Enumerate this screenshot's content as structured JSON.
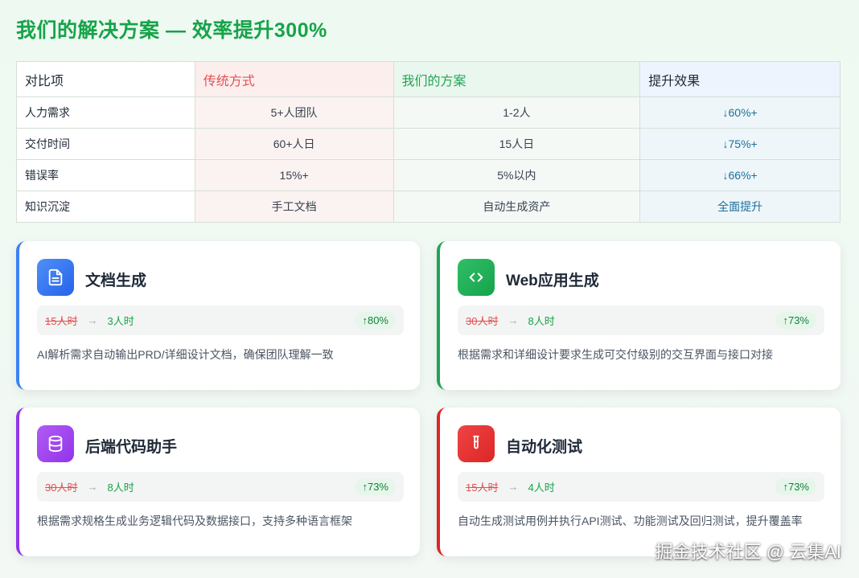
{
  "title": "我们的解决方案 — 效率提升300%",
  "table": {
    "headers": [
      "对比项",
      "传统方式",
      "我们的方案",
      "提升效果"
    ],
    "rows": [
      [
        "人力需求",
        "5+人团队",
        "1-2人",
        "↓60%+"
      ],
      [
        "交付时间",
        "60+人日",
        "15人日",
        "↓75%+"
      ],
      [
        "错误率",
        "15%+",
        "5%以内",
        "↓66%+"
      ],
      [
        "知识沉淀",
        "手工文档",
        "自动生成资产",
        "全面提升"
      ]
    ]
  },
  "cards": [
    {
      "title": "文档生成",
      "old": "15人时",
      "new": "3人时",
      "pct": "↑80%",
      "desc": "AI解析需求自动输出PRD/详细设计文档，确保团队理解一致",
      "icon": "document-icon",
      "color": "#3b82f6"
    },
    {
      "title": "Web应用生成",
      "old": "30人时",
      "new": "8人时",
      "pct": "↑73%",
      "desc": "根据需求和详细设计要求生成可交付级别的交互界面与接口对接",
      "icon": "code-icon",
      "color": "#22a355"
    },
    {
      "title": "后端代码助手",
      "old": "30人时",
      "new": "8人时",
      "pct": "↑73%",
      "desc": "根据需求规格生成业务逻辑代码及数据接口，支持多种语言框架",
      "icon": "database-icon",
      "color": "#9333ea"
    },
    {
      "title": "自动化测试",
      "old": "15人时",
      "new": "4人时",
      "pct": "↑73%",
      "desc": "自动生成测试用例并执行API测试、功能测试及回归测试，提升覆盖率",
      "icon": "test-tube-icon",
      "color": "#dc2626"
    }
  ],
  "arrow_glyph": "→",
  "watermark": "掘金技术社区 @ 云集AI"
}
